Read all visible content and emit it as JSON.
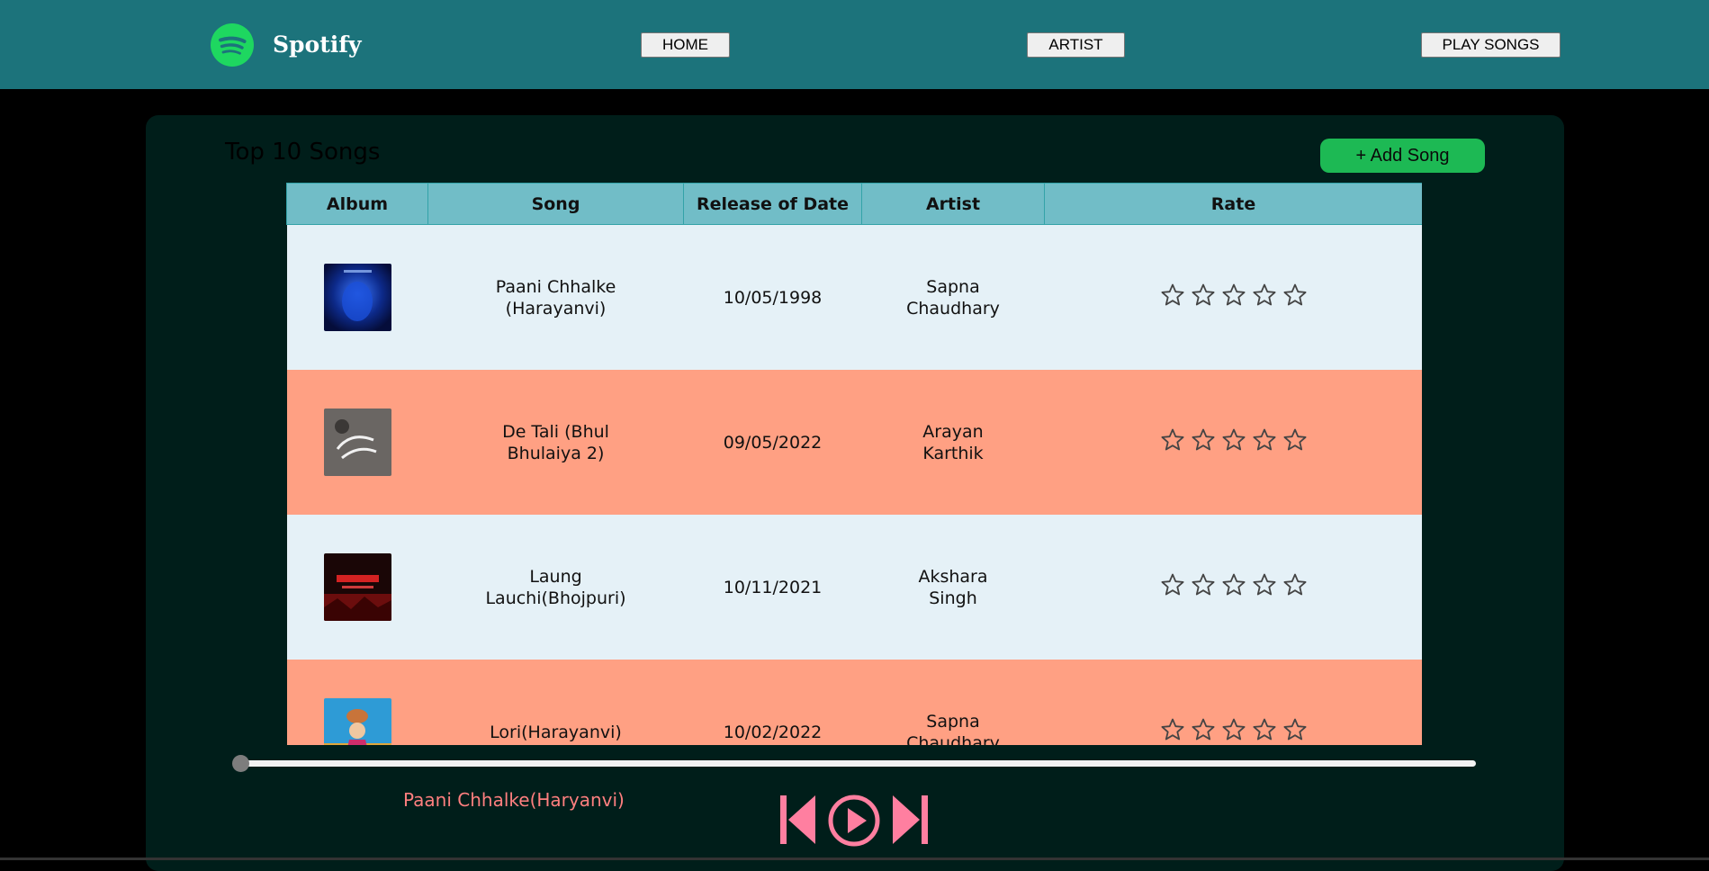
{
  "header": {
    "brand": "Spotify",
    "nav": {
      "home": "HOME",
      "artist": "ARTIST",
      "play_songs": "PLAY SONGS"
    }
  },
  "main": {
    "title": "Top 10 Songs",
    "add_song_label": "+ Add Song",
    "columns": [
      "Album",
      "Song",
      "Release of Date",
      "Artist",
      "Rate"
    ],
    "rows": [
      {
        "song_line1": "Paani Chhalke",
        "song_line2": "(Harayanvi)",
        "date": "10/05/1998",
        "artist_line1": "Sapna",
        "artist_line2": "Chaudhary",
        "rating": 0
      },
      {
        "song_line1": "De Tali (Bhul",
        "song_line2": "Bhulaiya 2)",
        "date": "09/05/2022",
        "artist_line1": "Arayan",
        "artist_line2": "Karthik",
        "rating": 0
      },
      {
        "song_line1": "Laung",
        "song_line2": "Lauchi(Bhojpuri)",
        "date": "10/11/2021",
        "artist_line1": "Akshara",
        "artist_line2": "Singh",
        "rating": 0
      },
      {
        "song_line1": "Lori(Harayanvi)",
        "song_line2": "",
        "date": "10/02/2022",
        "artist_line1": "Sapna",
        "artist_line2": "Chaudhary",
        "rating": 0
      }
    ]
  },
  "player": {
    "now_playing": "Paani Chhalke(Haryanvi)",
    "progress": 0
  },
  "colors": {
    "header_bg": "#1c737b",
    "panel_bg": "#001e1a",
    "accent_green": "#1db954",
    "row_light": "#e5f1f7",
    "row_salmon": "#ffa083",
    "table_header": "#71bdc7",
    "control_pink": "#ff7fa0"
  },
  "icons": {
    "logo": "spotify-logo-icon",
    "star": "star-outline-icon",
    "prev": "skip-previous-icon",
    "play": "play-circle-icon",
    "next": "skip-next-icon"
  }
}
